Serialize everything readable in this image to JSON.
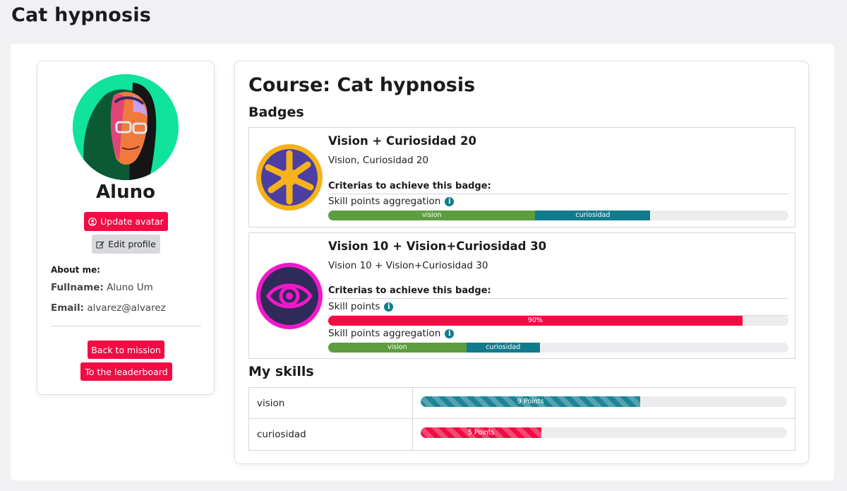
{
  "page": {
    "title": "Cat hypnosis"
  },
  "profile": {
    "name": "Aluno",
    "update_avatar_label": "Update avatar",
    "edit_profile_label": "Edit profile",
    "about_title": "About me:",
    "fullname_label": "Fullname:",
    "fullname_value": "Aluno Um",
    "email_label": "Email:",
    "email_value": "alvarez@alvarez",
    "back_to_mission_label": "Back to mission",
    "leaderboard_label": "To the leaderboard"
  },
  "course": {
    "title": "Course: Cat hypnosis",
    "badges_title": "Badges",
    "badges": [
      {
        "name": "Vision + Curiosidad 20",
        "description": "Vision, Curiosidad 20",
        "criteria_title": "Criterias to achieve this badge:",
        "icon": "hands-together-icon",
        "criteria": [
          {
            "label": "Skill points aggregation",
            "segments": [
              {
                "label": "vision",
                "fraction": 0.45,
                "color": "#5c9e3f"
              },
              {
                "label": "curiosidad",
                "fraction": 0.25,
                "color": "#117b8c"
              }
            ]
          }
        ]
      },
      {
        "name": "Vision 10 + Vision+Curiosidad 30",
        "description": "Vision 10 + Vision+Curiosidad 30",
        "criteria_title": "Criterias to achieve this badge:",
        "icon": "eye-icon",
        "criteria": [
          {
            "label": "Skill points",
            "segments": [
              {
                "label": "90%",
                "fraction": 0.9,
                "color": "#f30b44"
              }
            ]
          },
          {
            "label": "Skill points aggregation",
            "segments": [
              {
                "label": "vision",
                "fraction": 0.3,
                "color": "#5c9e3f"
              },
              {
                "label": "curiosidad",
                "fraction": 0.16,
                "color": "#117b8c"
              }
            ]
          }
        ]
      }
    ],
    "skills_title": "My skills",
    "skills": [
      {
        "name": "vision",
        "points_label": "9 Points",
        "fraction": 0.6,
        "color": "#1b8596"
      },
      {
        "name": "curiosidad",
        "points_label": "5 Points",
        "fraction": 0.33,
        "color": "#f30b44"
      }
    ]
  },
  "colors": {
    "accent_red": "#f30b44",
    "teal": "#117b8c",
    "green": "#5c9e3f",
    "avatar_bg": "#0fe39c"
  }
}
